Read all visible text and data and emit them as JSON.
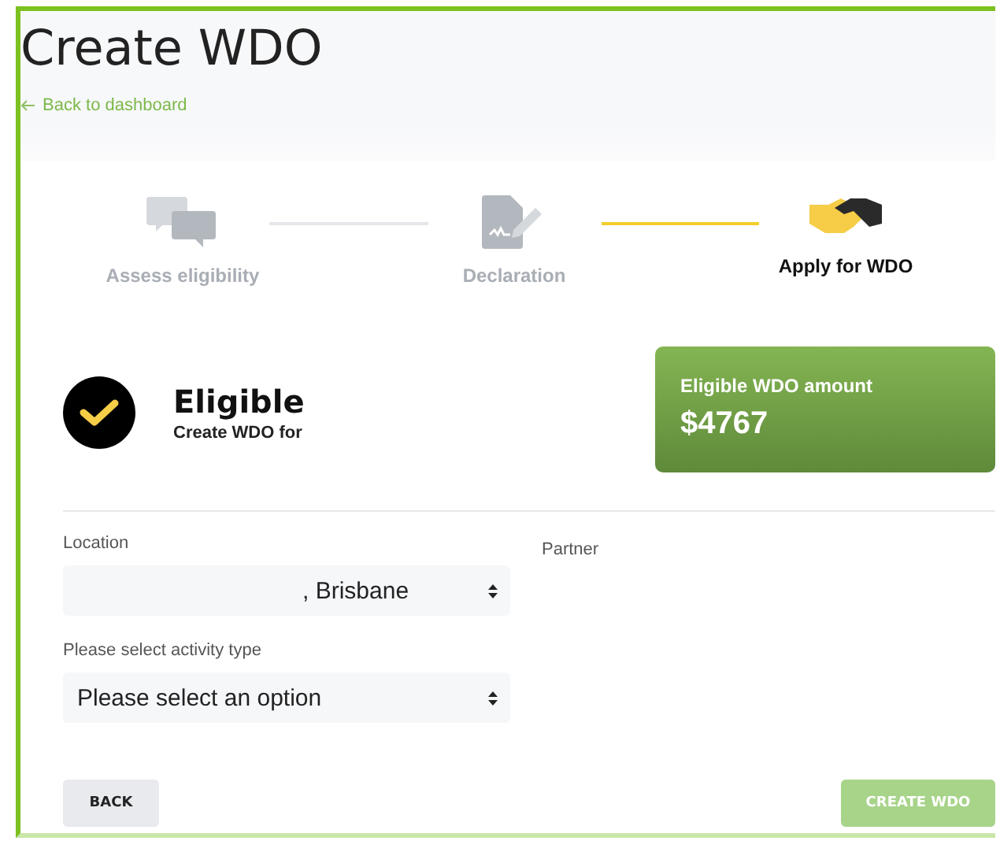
{
  "page": {
    "title": "Create WDO",
    "back_link": "Back to dashboard"
  },
  "steps": [
    {
      "label": "Assess eligibility",
      "kind": "chat",
      "selected": false
    },
    {
      "label": "Declaration",
      "kind": "document",
      "selected": false
    },
    {
      "label": "Apply for WDO",
      "kind": "handshake",
      "selected": true
    }
  ],
  "result": {
    "status": "Eligible",
    "subtitle": "Create WDO for",
    "checked": true
  },
  "amount_card": {
    "label": "Eligible WDO amount",
    "value": "$4767"
  },
  "form": {
    "fields": [
      {
        "label": "Location",
        "value": ", Brisbane"
      },
      {
        "label": "Please select activity type",
        "value": "Please select an option"
      }
    ],
    "partner_label": "Partner"
  },
  "buttons": [
    {
      "label": "BACK",
      "kind": "secondary",
      "disabled": false
    },
    {
      "label": "CREATE WDO",
      "kind": "primary",
      "disabled": true
    }
  ]
}
